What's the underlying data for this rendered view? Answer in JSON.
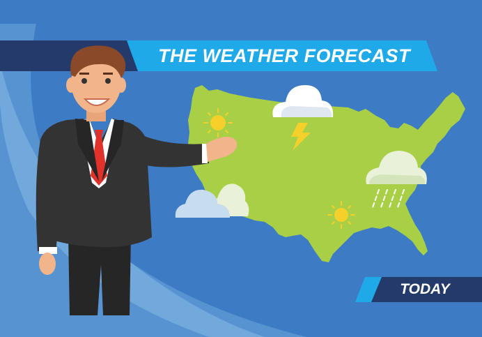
{
  "header": {
    "title": "THE WEATHER FORECAST"
  },
  "footer": {
    "label": "TODAY"
  },
  "colors": {
    "background": "#3d7bc4",
    "accent_cyan": "#1fa9e8",
    "navy": "#243a6b",
    "map_green": "#a8cf45",
    "sun_yellow": "#f5d02a",
    "cloud": "#ffffff",
    "suit": "#2f2f2f",
    "tie": "#e0312b"
  },
  "weather_icons": [
    "sun-icon",
    "storm-cloud-icon",
    "lightning-icon",
    "rain-cloud-icon",
    "partly-cloudy-icon",
    "sun-icon"
  ]
}
